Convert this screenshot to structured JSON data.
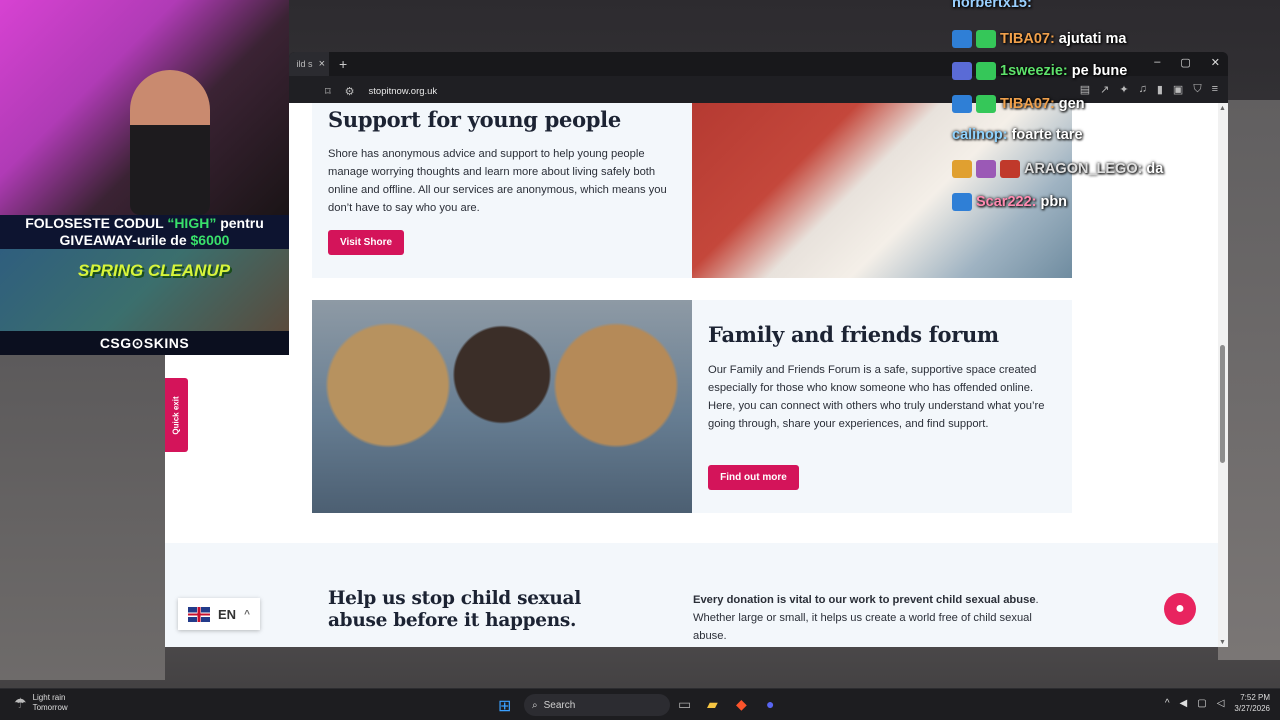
{
  "browser": {
    "tab_title": "ild s",
    "tab_close": "×",
    "new_tab": "+",
    "url": "stopitnow.org.uk",
    "window_controls": [
      "–",
      "▢",
      "✕"
    ]
  },
  "section1": {
    "heading": "Support for young people",
    "body": "Shore has anonymous advice and support to help young people manage worrying thoughts and learn more about living safely both online and offline. All our services are anonymous, which means you don’t have to say who you are.",
    "button": "Visit Shore"
  },
  "section2": {
    "heading": "Family and friends forum",
    "body": "Our Family and Friends Forum is a safe, supportive space created especially for those who know someone who has offended online. Here, you can connect with others who truly understand what you’re going through, share your experiences, and find support.",
    "button": "Find out more"
  },
  "section3": {
    "heading": "Help us stop child sexual abuse before it happens.",
    "body_bold": "Every donation is vital to our work to prevent child sexual abuse",
    "body_rest": ". Whether large or small, it helps us create a world free of child sexual abuse."
  },
  "quick_exit": "Quick exit",
  "language": {
    "code": "EN",
    "arrow": "^"
  },
  "overlay": {
    "promo_line1_a": "FOLOSESTE CODUL ",
    "promo_code": "“HIGH”",
    "promo_line1_b": " pentru",
    "promo_line2_a": "GIVEAWAY-urile de ",
    "promo_amount": "$6000",
    "game_title": "SPRING CLEANUP",
    "brand": "CSG⊙SKINS"
  },
  "chat": [
    {
      "user": "norbertx15:",
      "text": "",
      "color": "#9ad0ff"
    },
    {
      "user": "TIBA07:",
      "text": "ajutati ma",
      "color": "#f0a04b"
    },
    {
      "user": "1sweezie:",
      "text": "pe bune",
      "color": "#5ee26b"
    },
    {
      "user": "TIBA07:",
      "text": "gen",
      "color": "#f0a04b"
    },
    {
      "user": "calinop:",
      "text": "foarte tare",
      "color": "#8fd3ff"
    },
    {
      "user": "ARAGON_LEGO:",
      "text": "da",
      "color": "#e0e0e0"
    },
    {
      "user": "Scar222:",
      "text": "pbn",
      "color": "#ff8ab0"
    }
  ],
  "taskbar": {
    "weather": "Light rain",
    "weather_sub": "Tomorrow",
    "search": "Search",
    "time": "7:52 PM",
    "date": "3/27/2026"
  },
  "colors": {
    "accent": "#d4145a",
    "card_bg": "#f3f7fb",
    "heading": "#1c2333"
  }
}
